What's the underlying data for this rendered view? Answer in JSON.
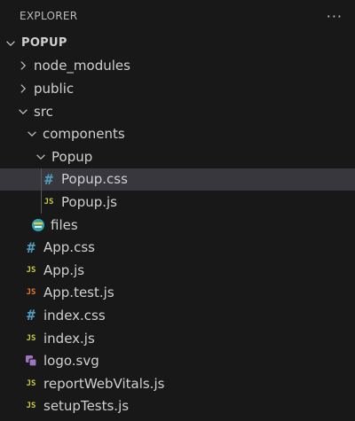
{
  "explorer": {
    "title": "EXPLORER",
    "more_label": "···"
  },
  "tree": {
    "root_label": "POPUP",
    "node_modules": "node_modules",
    "public": "public",
    "src": "src",
    "components": "components",
    "popup_folder": "Popup",
    "popup_css": "Popup.css",
    "popup_js": "Popup.js",
    "files": "files",
    "app_css": "App.css",
    "app_js": "App.js",
    "app_test": "App.test.js",
    "index_css": "index.css",
    "index_js": "index.js",
    "logo": "logo.svg",
    "report": "reportWebVitals.js",
    "setup": "setupTests.js"
  },
  "icons": {
    "css_glyph": "#",
    "js_glyph": "JS"
  },
  "colors": {
    "background": "#181818",
    "selected_row": "#37373d",
    "css_icon": "#519aba",
    "js_icon": "#cbcb41",
    "test_icon": "#e37933",
    "svg_icon": "#a074c4"
  }
}
